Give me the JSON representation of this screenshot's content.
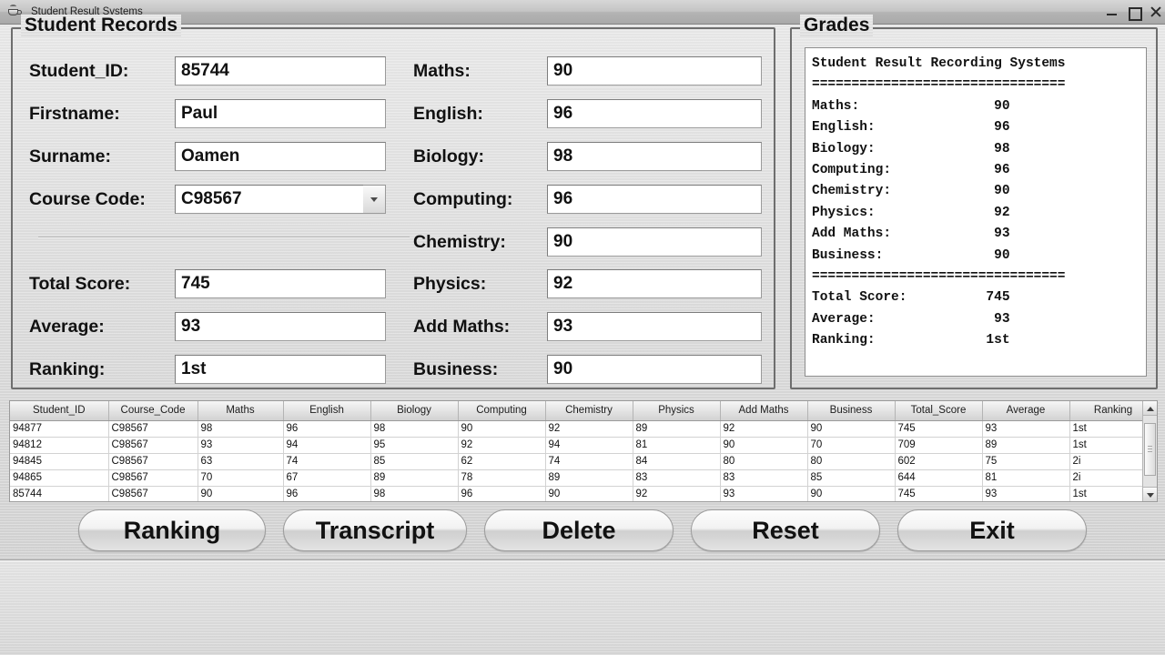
{
  "window": {
    "title": "Student Result Systems",
    "icon": "java-coffee-cup-icon",
    "controls": {
      "minimize": "–",
      "maximize": "☐",
      "close": "✕"
    }
  },
  "student_records": {
    "title": "Student Records",
    "left_fields": [
      {
        "label": "Student_ID:",
        "value": "85744"
      },
      {
        "label": "Firstname:",
        "value": "Paul"
      },
      {
        "label": "Surname:",
        "value": "Oamen"
      },
      {
        "label": "Course Code:",
        "value": "C98567"
      }
    ],
    "summary_fields": [
      {
        "label": "Total Score:",
        "value": "745"
      },
      {
        "label": "Average:",
        "value": "93"
      },
      {
        "label": "Ranking:",
        "value": "1st"
      }
    ],
    "subject_fields": [
      {
        "label": "Maths:",
        "value": "90"
      },
      {
        "label": "English:",
        "value": "96"
      },
      {
        "label": "Biology:",
        "value": "98"
      },
      {
        "label": "Computing:",
        "value": "96"
      },
      {
        "label": "Chemistry:",
        "value": "90"
      },
      {
        "label": "Physics:",
        "value": "92"
      },
      {
        "label": "Add Maths:",
        "value": "93"
      },
      {
        "label": "Business:",
        "value": "90"
      }
    ]
  },
  "grades": {
    "title": "Grades",
    "text": "Student Result Recording Systems\n================================\nMaths:                 90\nEnglish:               96\nBiology:               98\nComputing:             96\nChemistry:             90\nPhysics:               92\nAdd Maths:             93\nBusiness:              90\n================================\nTotal Score:          745\nAverage:               93\nRanking:              1st"
  },
  "table": {
    "columns": [
      "Student_ID",
      "Course_Code",
      "Maths",
      "English",
      "Biology",
      "Computing",
      "Chemistry",
      "Physics",
      "Add Maths",
      "Business",
      "Total_Score",
      "Average",
      "Ranking"
    ],
    "rows": [
      [
        "94877",
        "C98567",
        "98",
        "96",
        "98",
        "90",
        "92",
        "89",
        "92",
        "90",
        "745",
        "93",
        "1st"
      ],
      [
        "94812",
        "C98567",
        "93",
        "94",
        "95",
        "92",
        "94",
        "81",
        "90",
        "70",
        "709",
        "89",
        "1st"
      ],
      [
        "94845",
        "C98567",
        "63",
        "74",
        "85",
        "62",
        "74",
        "84",
        "80",
        "80",
        "602",
        "75",
        "2i"
      ],
      [
        "94865",
        "C98567",
        "70",
        "67",
        "89",
        "78",
        "89",
        "83",
        "83",
        "85",
        "644",
        "81",
        "2i"
      ],
      [
        "85744",
        "C98567",
        "90",
        "96",
        "98",
        "96",
        "90",
        "92",
        "93",
        "90",
        "745",
        "93",
        "1st"
      ]
    ]
  },
  "buttons": {
    "ranking": "Ranking",
    "transcript": "Transcript",
    "delete": "Delete",
    "reset": "Reset",
    "exit": "Exit"
  }
}
